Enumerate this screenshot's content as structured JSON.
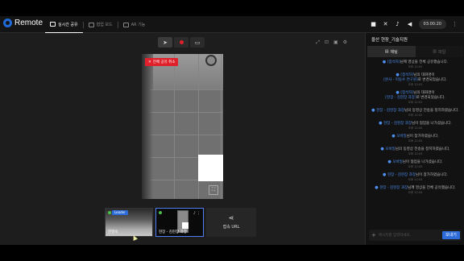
{
  "app": {
    "name": "Remote"
  },
  "tabs": [
    {
      "label": "실시간 공유",
      "icon": "screen-share-icon",
      "active": true
    },
    {
      "label": "협업 보드",
      "icon": "board-icon",
      "active": false
    },
    {
      "label": "AR 기능",
      "icon": "ar-cube-icon",
      "active": false
    }
  ],
  "header": {
    "timer": "03:00:20"
  },
  "stage": {
    "share_badge": "전체 공유 취소"
  },
  "participants": [
    {
      "name": "한영숙",
      "badge": "Leader",
      "status_color": "#4cbf4c"
    },
    {
      "name": "현장 - 김현장 과장",
      "badge": "",
      "status_color": "#4cbf4c"
    }
  ],
  "url_card": {
    "label": "접속 URL"
  },
  "sidebar": {
    "title": "울산 현장_기술지원",
    "tabs": [
      {
        "label": "채팅",
        "active": true
      },
      {
        "label": "파일",
        "active": false
      }
    ],
    "messages": [
      {
        "parts": [
          "",
          "[참석자]",
          "님께 영상을 전체 공유했습니다."
        ],
        "time": "오후 12:01"
      },
      {
        "parts": [
          "",
          "[참석자]",
          "님의 대화명이"
        ],
        "extra": [
          "[본사 - 이동수 연구원]",
          "로 변경되었습니다."
        ],
        "time": "오후 12:01"
      },
      {
        "parts": [
          "",
          "[참석자]",
          "님의 대화명이"
        ],
        "extra": [
          "[현장 - 김현장 과장]",
          "로 변경되었습니다."
        ],
        "time": "오후 12:01"
      },
      {
        "parts": [
          "",
          "현장 - 김현장 과장",
          "님의 동영상 전송을 정지하였습니다."
        ],
        "time": "오후 12:02"
      },
      {
        "parts": [
          "",
          "현장 - 김현장 과장",
          "님이 협업을 나가셨습니다."
        ],
        "time": "오후 12:02"
      },
      {
        "parts": [
          "",
          "오바일",
          "님이 참가하였습니다."
        ],
        "time": "오후 12:02"
      },
      {
        "parts": [
          "",
          "오바일",
          "님의 동영상 전송을 정지하였습니다."
        ],
        "time": "오후 12:03"
      },
      {
        "parts": [
          "",
          "오바일",
          "님이 협업을 나가셨습니다."
        ],
        "time": "오후 12:03"
      },
      {
        "parts": [
          "",
          "현장 - 김현장 과장",
          "님이 참가하였습니다."
        ],
        "time": "오후 12:03"
      },
      {
        "parts": [
          "",
          "현장 - 김현장 과장",
          "님께 영상을 전체 공유했습니다."
        ],
        "time": "오후 12:04"
      }
    ],
    "input_placeholder": "메시지를 입력하세요.",
    "send_label": "보내기"
  },
  "colors": {
    "accent": "#2d6bd8",
    "record": "#e0202a",
    "online": "#4cbf4c"
  }
}
